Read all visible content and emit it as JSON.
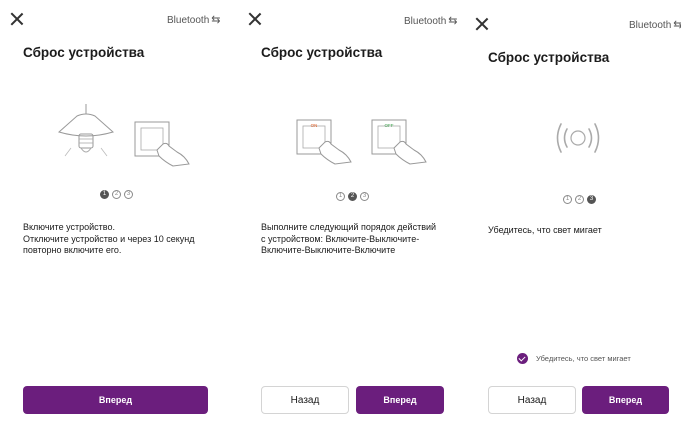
{
  "bluetooth_label": "Bluetooth",
  "bluetooth_arrows": "⇆",
  "accent_color": "#6b1e7d",
  "step1": {
    "title": "Сброс устройства",
    "steps": [
      "1",
      "2",
      "3"
    ],
    "active_step": 1,
    "lines": [
      "Включите устройство.",
      "Отключите устройство и через 10 секунд",
      "повторно включите его."
    ],
    "next_label": "Вперед"
  },
  "step2": {
    "title": "Сброс устройства",
    "steps": [
      "1",
      "2",
      "3"
    ],
    "active_step": 2,
    "switch_on_label": "ON",
    "switch_off_label": "OFF",
    "lines": [
      "Выполните следующий порядок действий",
      "с устройством: Включите-Выключите-",
      "Включите-Выключите-Включите"
    ],
    "back_label": "Назад",
    "next_label": "Вперед"
  },
  "step3": {
    "title": "Сброс устройства",
    "steps": [
      "1",
      "2",
      "3"
    ],
    "active_step": 3,
    "lines": [
      "Убедитесь, что свет мигает"
    ],
    "confirm_label": "Убедитесь, что свет мигает",
    "confirm_checked": true,
    "back_label": "Назад",
    "next_label": "Вперед"
  }
}
